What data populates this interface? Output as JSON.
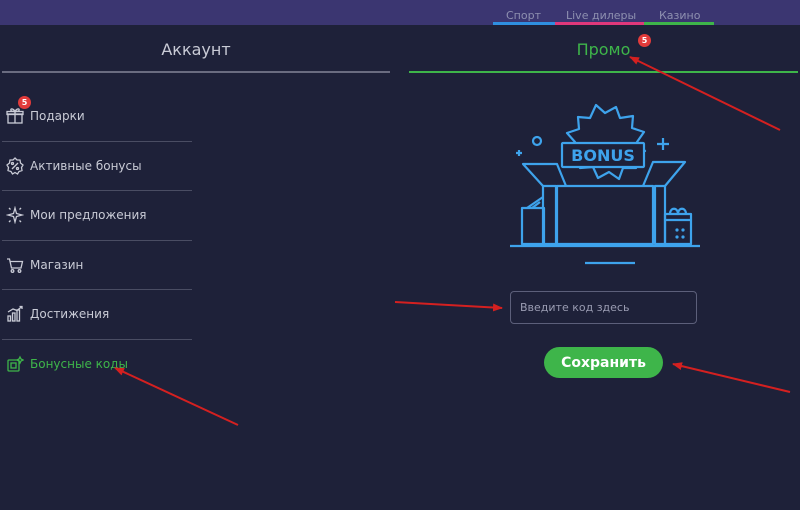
{
  "top_nav": [
    {
      "label": "Спорт",
      "color": "#2f8fe0"
    },
    {
      "label": "Live дилеры",
      "color": "#e0387b"
    },
    {
      "label": "Казино",
      "color": "#3eb54a"
    }
  ],
  "tabs": {
    "account": "Аккаунт",
    "promo": "Промо",
    "promo_badge": "5"
  },
  "menu": {
    "gifts_badge": "5",
    "items": [
      {
        "label": "Подарки",
        "icon": "gift-icon"
      },
      {
        "label": "Активные бонусы",
        "icon": "percent-badge-icon"
      },
      {
        "label": "Мои предложения",
        "icon": "sparkle-icon"
      },
      {
        "label": "Магазин",
        "icon": "cart-icon"
      },
      {
        "label": "Достижения",
        "icon": "chart-bars-icon"
      },
      {
        "label": "Бонусные коды",
        "icon": "bonus-code-icon"
      }
    ]
  },
  "promo": {
    "illustration_text": "BONUS",
    "input_placeholder": "Введите код здесь",
    "save_label": "Сохранить"
  },
  "colors": {
    "background": "#1e2139",
    "topbar": "#3b3671",
    "accent_green": "#3eb54a",
    "illustration_blue": "#3ea3ec",
    "badge_red": "#e23b3b",
    "annotation_red": "#d42020"
  }
}
